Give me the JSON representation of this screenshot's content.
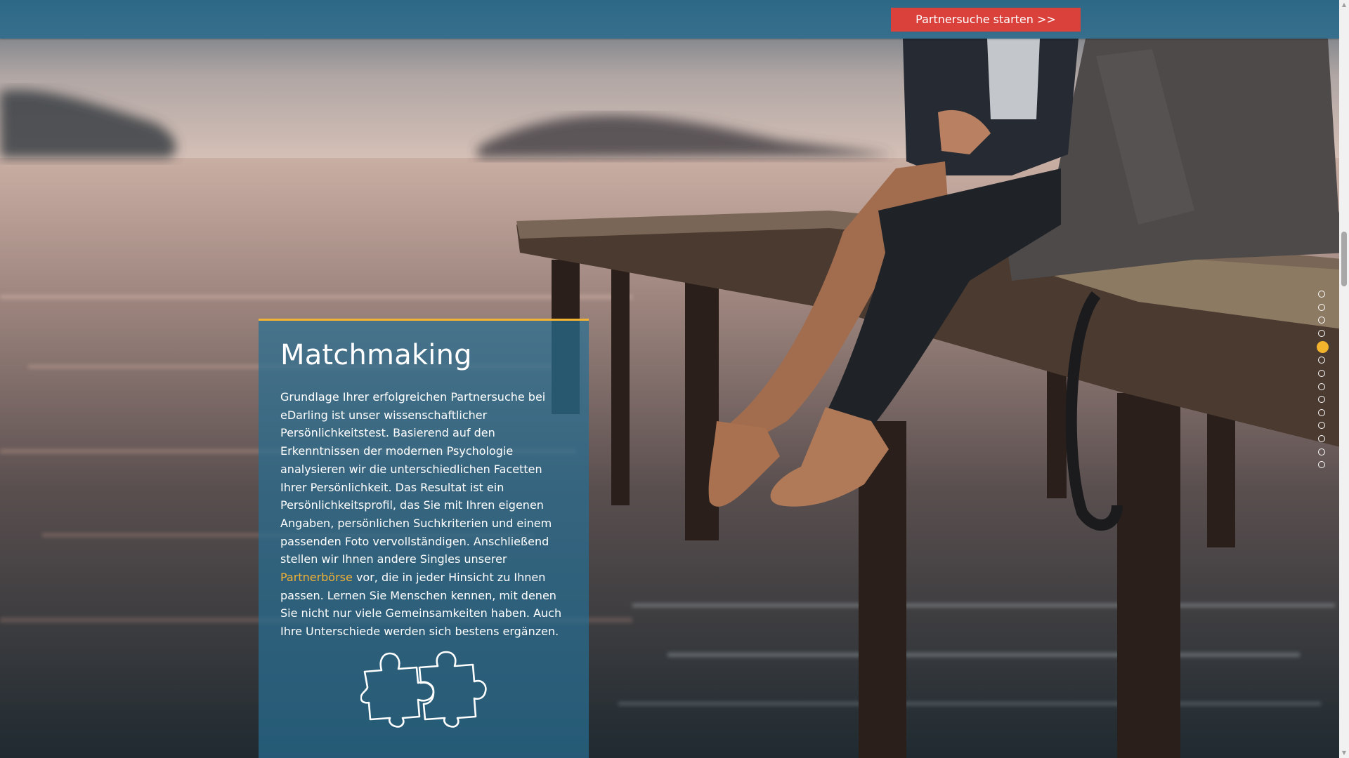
{
  "header": {
    "cta_label": "Partnersuche starten >>"
  },
  "card": {
    "title": "Matchmaking",
    "text_before_link": "Grundlage Ihrer erfolgreichen Partnersuche bei eDarling ist unser wissenschaftlicher Persönlichkeitstest. Basierend auf den Erkenntnissen der modernen Psychologie analysieren wir die unterschiedlichen Facetten Ihrer Persönlichkeit. Das Resultat ist ein Persönlichkeitsprofil, das Sie mit Ihren eigenen Angaben, persönlichen Suchkriterien und einem passenden Foto vervollständigen. Anschließend stellen wir Ihnen andere Singles unserer ",
    "link_label": "Partnerbörse",
    "text_after_link": " vor, die in jeder Hinsicht zu Ihnen passen. Lernen Sie Menschen kennen, mit denen Sie nicht nur viele Gemeinsamkeiten haben. Auch Ihre Unterschiede werden sich bestens ergänzen.",
    "icon": "puzzle-icon"
  },
  "slide_nav": {
    "count": 14,
    "active_index": 4
  },
  "colors": {
    "topbar": "#20688c",
    "cta": "#d9413a",
    "accent": "#f2b233",
    "card": "#286e92"
  }
}
